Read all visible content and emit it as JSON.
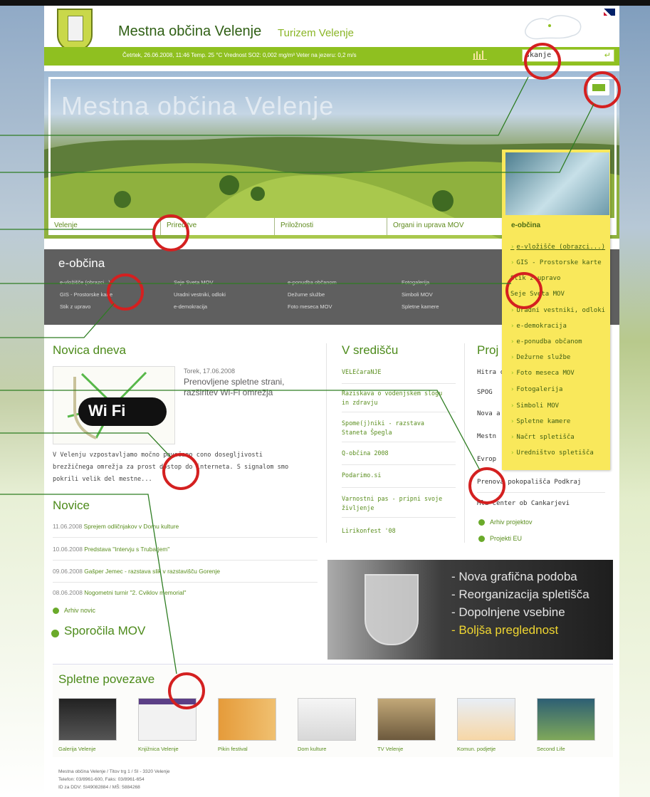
{
  "header": {
    "site_title": "Mestna občina Velenje",
    "site_subtitle": "Turizem Velenje",
    "info_line": "Četrtek, 26.06.2008, 11:46   Temp. 25 °C   Vrednost SO2: 0,002 mg/m³   Veter na jezeru: 0,2 m/s",
    "search_value": "skanje"
  },
  "hero": {
    "title": "Mestna občina Velenje"
  },
  "tabs": [
    {
      "label": "Velenje"
    },
    {
      "label": "Prireditve"
    },
    {
      "label": "Priložnosti"
    },
    {
      "label": "Organi in uprava MOV"
    },
    {
      "label": "e-občina"
    }
  ],
  "eobcina": {
    "title": "e-občina",
    "links": [
      "e-vložišče (obrazci...)",
      "GIS - Prostorske karte",
      "Stik z upravo",
      "Seje Sveta MOV",
      "Uradni vestniki, odloki",
      "e-demokracija",
      "e-ponudba občanom",
      "Dežurne službe",
      "Foto meseca MOV",
      "Fotogalerija",
      "Simboli MOV",
      "Spletne kamere"
    ]
  },
  "dropdown": {
    "items": [
      "e-vložišče (obrazci...)",
      "GIS - Prostorske karte",
      "Stik z upravo",
      "Seje Sveta MOV",
      "Uradni vestniki, odloki",
      "e-demokracija",
      "e-ponudba občanom",
      "Dežurne službe",
      "Foto meseca MOV",
      "Fotogalerija",
      "Simboli MOV",
      "Spletne kamere",
      "Načrt spletišča",
      "Uredništvo spletišča"
    ]
  },
  "novica_dneva": {
    "heading": "Novica dneva",
    "date": "Torek, 17.06.2008",
    "headline": "Prenovljene spletne strani, razširitev Wi-Fi omrežja",
    "badge": "Wi Fi",
    "body": "V Velenju vzpostavljamo močno povečano cono dosegljivosti brezžičnega omrežja za prost dostop do interneta. S signalom smo pokrili velik del mestne..."
  },
  "novice": {
    "heading": "Novice",
    "items": [
      {
        "date": "11.06.2008",
        "title": "Sprejem odličnjakov v Domu kulture"
      },
      {
        "date": "10.06.2008",
        "title": "Predstava \"Intervju s Trubarjem\""
      },
      {
        "date": "09.06.2008",
        "title": "Gašper Jemec - razstava slik v razstavišču Gorenje"
      },
      {
        "date": "08.06.2008",
        "title": "Nogometni turnir \"2. Cviklov memorial\""
      }
    ],
    "archive": "Arhiv novic",
    "sporocila": "Sporočila MOV"
  },
  "v_sredniscu": {
    "heading": "V središču",
    "items": [
      "VELEčaraNJE",
      "Raziskava o vodenjskem slogu in zdravju",
      "Spome(j)niki - razstava Staneta Špegla",
      "Q-občina 2008",
      "Podarimo.si",
      "Varnostni pas - pripni svoje življenje",
      "Lirikonfest '08"
    ]
  },
  "projekti": {
    "heading": "Proj",
    "items": [
      "Hitra c",
      "SPOG",
      "Nova a",
      "Mestn",
      "Evrop",
      "Prenova pokopališča Podkraj",
      "Mla center ob Cankarjevi"
    ],
    "archive": "Arhiv projektov",
    "eu": "Projekti EU"
  },
  "promo": {
    "lines": [
      "- Nova grafična podoba",
      "- Reorganizacija spletišča",
      "- Dopolnjene vsebine",
      "- Boljša preglednost"
    ]
  },
  "links": {
    "heading": "Spletne povezave",
    "items": [
      "Galerija Velenje",
      "Knjižnica Velenje",
      "Pikin festival",
      "Dom kulture",
      "TV Velenje",
      "Komun. podjetje",
      "Second Life"
    ]
  },
  "footer": {
    "line1": "Mestna občina Velenje / Titov trg 1 / SI - 3320 Velenje",
    "line2": "Telefon: 03/8961-600, Faks: 03/8961-654",
    "line3": "ID za DDV: SI49082884 / MŠ: 5884268"
  },
  "colors": {
    "brand_green": "#8fc020",
    "link_green": "#5a8e1e",
    "dropdown_yellow": "#f9e85b",
    "annotation_red": "#d42020",
    "panel_gray": "#5f5f5f"
  }
}
